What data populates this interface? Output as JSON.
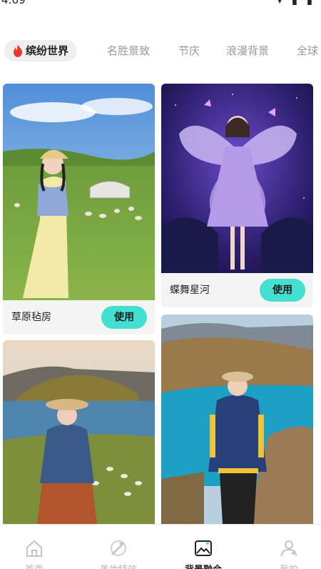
{
  "status": {
    "time": "4:09",
    "right_icons": "▾ ▮ ▮"
  },
  "tabs": [
    {
      "label": "缤纷世界",
      "active": true
    },
    {
      "label": "名胜景致",
      "active": false
    },
    {
      "label": "节庆",
      "active": false
    },
    {
      "label": "浪漫背景",
      "active": false
    },
    {
      "label": "全球",
      "active": false
    }
  ],
  "cards": [
    {
      "title": "草原毡房",
      "button": "使用"
    },
    {
      "title": "蝶舞星河",
      "button": "使用"
    },
    {
      "title": "",
      "button": ""
    },
    {
      "title": "",
      "button": ""
    }
  ],
  "nav": [
    {
      "label": "首页",
      "icon": "home-icon",
      "active": false
    },
    {
      "label": "美妆特效",
      "icon": "magic-wand-icon",
      "active": false
    },
    {
      "label": "背景融合",
      "icon": "image-edit-icon",
      "active": true
    },
    {
      "label": "我的",
      "icon": "profile-icon",
      "active": false
    }
  ],
  "colors": {
    "accent": "#43e0d2",
    "fire": "#e8392b"
  }
}
